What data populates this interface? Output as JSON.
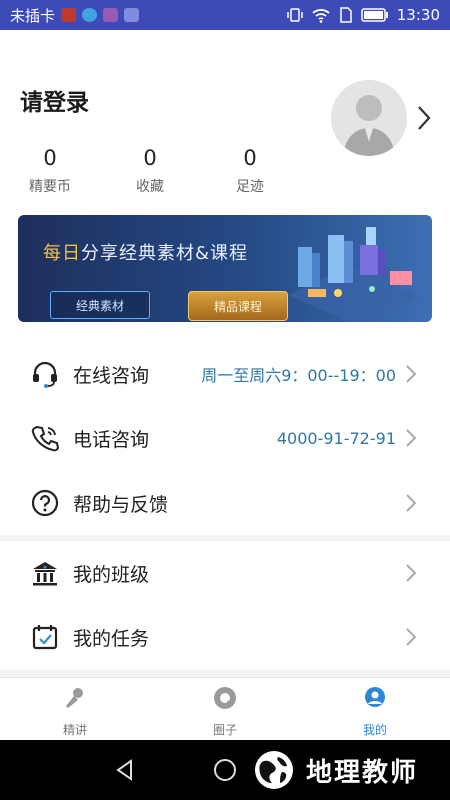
{
  "status_bar": {
    "carrier": "未插卡",
    "time": "13:30"
  },
  "profile": {
    "login_prompt": "请登录",
    "stats": [
      {
        "value": "0",
        "label": "精要币"
      },
      {
        "value": "0",
        "label": "收藏"
      },
      {
        "value": "0",
        "label": "足迹"
      }
    ]
  },
  "banner": {
    "title_highlight": "每日",
    "title_rest": "分享经典素材&课程",
    "button1": "经典素材",
    "button2": "精品课程"
  },
  "menu": {
    "online": {
      "label": "在线咨询",
      "value": "周一至周六9：00--19：00",
      "icon": "headset-icon"
    },
    "phone": {
      "label": "电话咨询",
      "value": "4000-91-72-91",
      "icon": "phone-icon"
    },
    "help": {
      "label": "帮助与反馈",
      "icon": "help-icon"
    },
    "class": {
      "label": "我的班级",
      "icon": "school-icon"
    },
    "task": {
      "label": "我的任务",
      "icon": "calendar-check-icon"
    }
  },
  "tabs": [
    {
      "label": "精讲",
      "icon": "microphone-icon"
    },
    {
      "label": "圈子",
      "icon": "chat-icon"
    },
    {
      "label": "我的",
      "icon": "user-icon",
      "active": true
    }
  ],
  "watermark": {
    "text": "地理教师"
  },
  "colors": {
    "status_bar": "#3d4bb8",
    "accent": "#2d86d9",
    "value_text": "#2f79a8"
  }
}
